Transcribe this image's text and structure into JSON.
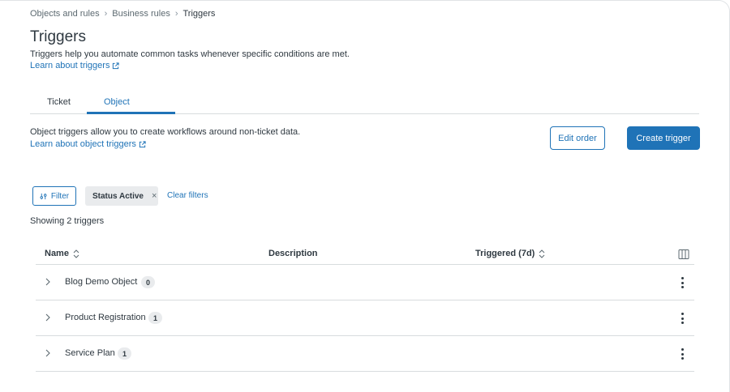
{
  "breadcrumb": {
    "items": [
      "Objects and rules",
      "Business rules",
      "Triggers"
    ]
  },
  "header": {
    "title": "Triggers",
    "subtitle": "Triggers help you automate common tasks whenever specific conditions are met.",
    "learn_link": "Learn about triggers"
  },
  "tabs": [
    {
      "label": "Ticket",
      "active": false
    },
    {
      "label": "Object",
      "active": true
    }
  ],
  "object_section": {
    "description": "Object triggers allow you to create workflows around non-ticket data.",
    "learn_link": "Learn about object triggers",
    "edit_order_label": "Edit order",
    "create_label": "Create trigger"
  },
  "filters": {
    "filter_label": "Filter",
    "active_tag": "Status Active",
    "clear_label": "Clear filters"
  },
  "results": {
    "showing": "Showing 2 triggers"
  },
  "table": {
    "columns": [
      "Name",
      "Description",
      "Triggered (7d)"
    ],
    "rows": [
      {
        "name": "Blog Demo Object",
        "count": "0"
      },
      {
        "name": "Product Registration",
        "count": "1"
      },
      {
        "name": "Service Plan",
        "count": "1"
      }
    ]
  },
  "colors": {
    "accent": "#1f73b7",
    "text": "#2f3941",
    "border": "#d8dcde",
    "tag_bg": "#e9ebed"
  },
  "icons": {
    "external": "external-link-icon",
    "sort": "sort-icon",
    "filter": "filter-icon",
    "close": "close-icon",
    "columns": "columns-icon",
    "chevron": "chevron-right-icon",
    "overflow": "kebab-menu-icon"
  }
}
